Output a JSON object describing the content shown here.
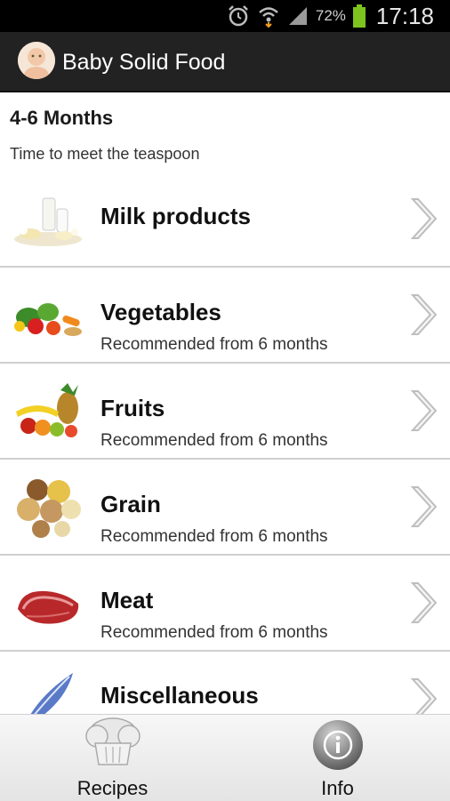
{
  "status": {
    "battery_pct": "72%",
    "time": "17:18"
  },
  "app": {
    "title": "Baby Solid Food"
  },
  "section": {
    "age": "4-6 Months",
    "subtitle": "Time to meet the teaspoon"
  },
  "categories": [
    {
      "title": "Milk products",
      "subtitle": "",
      "icon": "milk-products-image"
    },
    {
      "title": "Vegetables",
      "subtitle": "Recommended from 6 months",
      "icon": "vegetables-image"
    },
    {
      "title": "Fruits",
      "subtitle": "Recommended from 6 months",
      "icon": "fruits-image"
    },
    {
      "title": "Grain",
      "subtitle": "Recommended from 6 months",
      "icon": "grain-image"
    },
    {
      "title": "Meat",
      "subtitle": "Recommended from 6 months",
      "icon": "meat-image"
    },
    {
      "title": "Miscellaneous",
      "subtitle": "",
      "icon": "feather-image"
    }
  ],
  "tabs": [
    {
      "label": "Recipes",
      "icon": "chef-hat-icon"
    },
    {
      "label": "Info",
      "icon": "info-icon"
    }
  ],
  "colors": {
    "appbar": "#222222",
    "statusbar": "#000000",
    "battery": "#7dc41f",
    "divider": "#cfcfcf"
  }
}
